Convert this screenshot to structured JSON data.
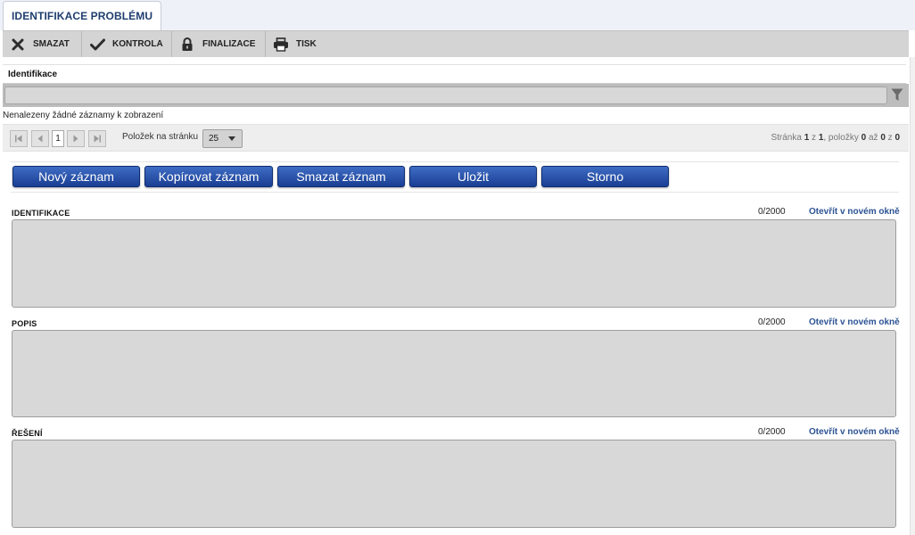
{
  "page": {
    "title": "IDENTIFIKACE PROBLÉMU"
  },
  "toolbar": {
    "delete": {
      "label": "SMAZAT",
      "icon": "close-icon"
    },
    "check": {
      "label": "KONTROLA",
      "icon": "check-icon"
    },
    "finalize": {
      "label": "FINALIZACE",
      "icon": "lock-icon"
    },
    "print": {
      "label": "TISK",
      "icon": "printer-icon"
    }
  },
  "list": {
    "column_header": "Identifikace",
    "filter_value": "",
    "empty_message": "Nenalezeny žádné záznamy k zobrazení"
  },
  "pager": {
    "current_page": "1",
    "per_page_label": "Položek na stránku",
    "per_page_value": "25",
    "status_prefix": "Stránka",
    "page": "1",
    "of_word": "z",
    "pages": "1",
    "items_word": ", položky",
    "from": "0",
    "to_word": "až",
    "to": "0",
    "total_word": "z",
    "total": "0"
  },
  "actions": {
    "new": "Nový záznam",
    "copy": "Kopírovat záznam",
    "delete": "Smazat záznam",
    "save": "Uložit",
    "cancel": "Storno"
  },
  "fields": {
    "identification": {
      "label": "IDENTIFIKACE",
      "count": "0/2000",
      "link": "Otevřít v novém okně"
    },
    "description": {
      "label": "POPIS",
      "count": "0/2000",
      "link": "Otevřít v novém okně"
    },
    "solution": {
      "label": "ŘEŠENÍ",
      "count": "0/2000",
      "link": "Otevřít v novém okně"
    }
  },
  "colors": {
    "accent": "#1f3e6e",
    "button_primary": "#2a52a8",
    "link": "#2c5394",
    "toolbar_bg": "#d4d4d4",
    "field_bg": "#d8d8d8"
  }
}
